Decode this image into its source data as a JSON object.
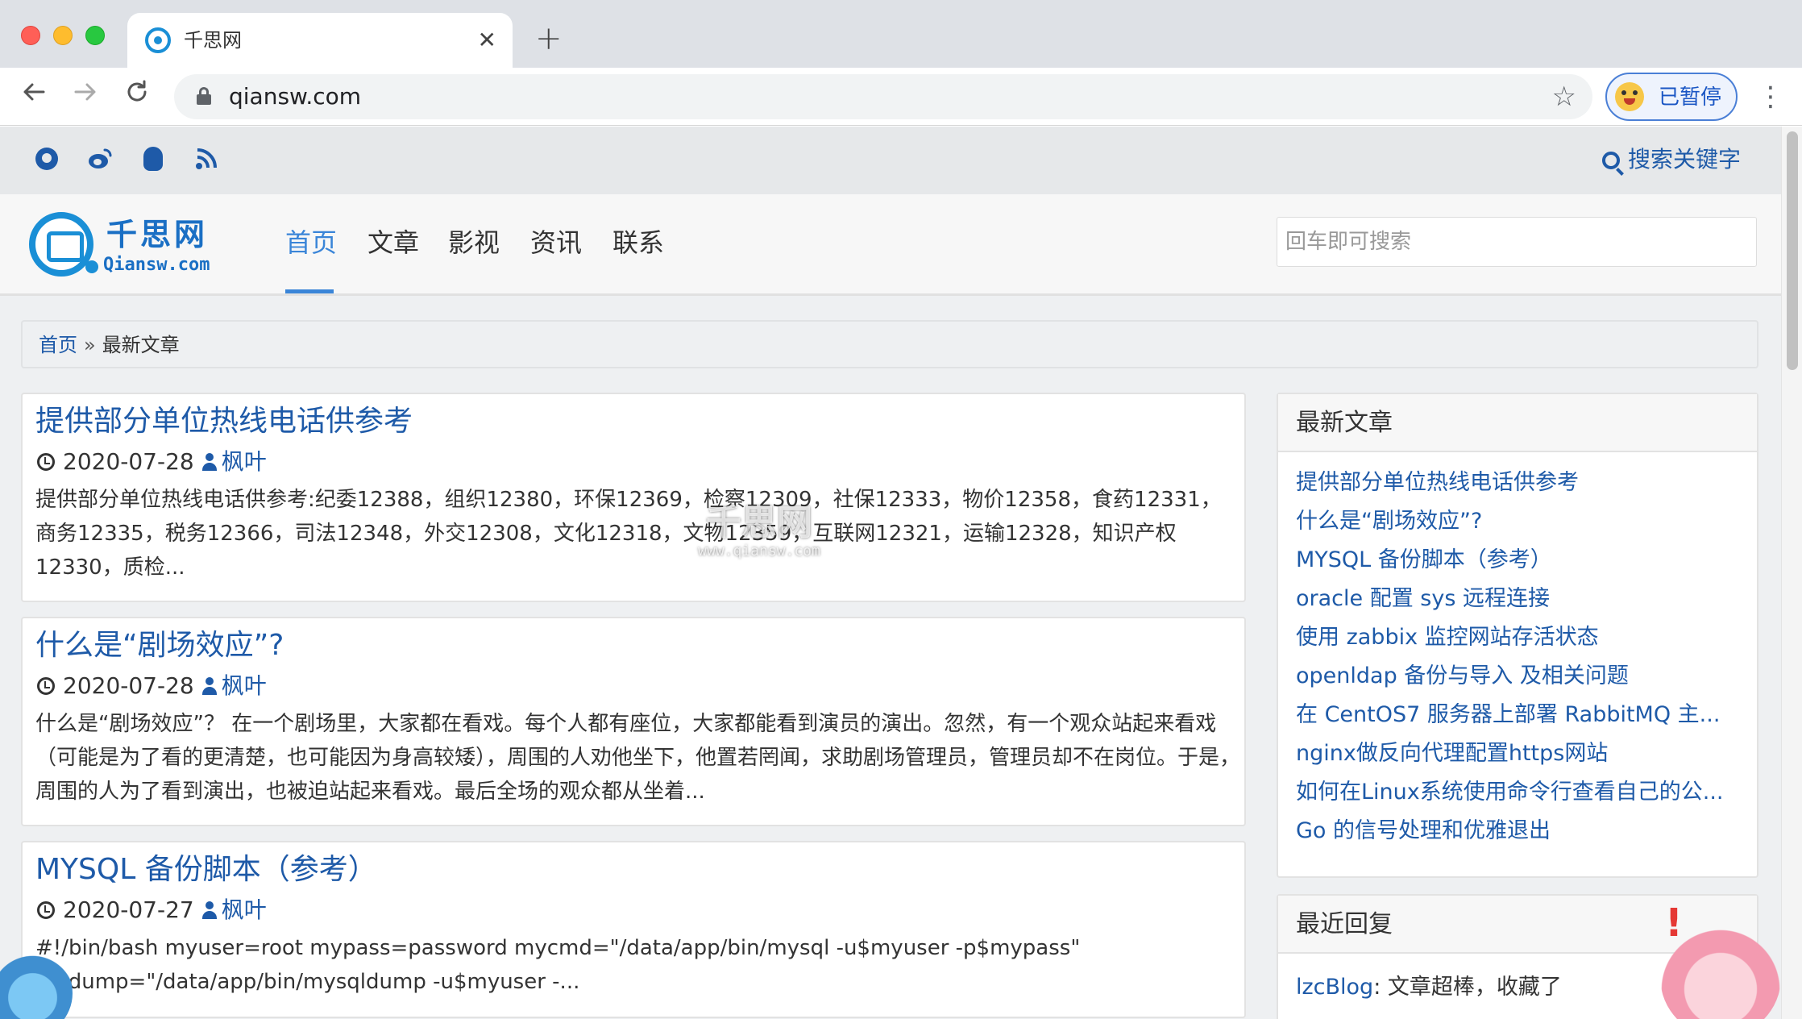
{
  "browser": {
    "tab_title": "千思网",
    "tab_close": "✕",
    "new_tab": "+",
    "url": "qiansw.com",
    "profile_label": "已暂停",
    "icons": {
      "back": "arrow-left-icon",
      "forward": "arrow-right-icon",
      "reload": "reload-icon",
      "lock": "lock-icon",
      "star": "star-icon",
      "menu": "kebab-menu-icon"
    }
  },
  "site": {
    "topbar": {
      "social_icons": [
        "github-icon",
        "weibo-icon",
        "qq-icon",
        "rss-icon"
      ],
      "search_label": "搜索关键字"
    },
    "logo": {
      "cn": "千思网",
      "en": "Qiansw.com"
    },
    "nav": [
      {
        "label": "首页",
        "active": true
      },
      {
        "label": "文章",
        "active": false
      },
      {
        "label": "影视",
        "active": false
      },
      {
        "label": "资讯",
        "active": false
      },
      {
        "label": "联系",
        "active": false
      }
    ],
    "search_placeholder": "回车即可搜索",
    "breadcrumb": {
      "home": "首页",
      "separator": "»",
      "current": "最新文章"
    },
    "posts": [
      {
        "title": "提供部分单位热线电话供参考",
        "date": "2020-07-28",
        "author": "枫叶",
        "excerpt": "提供部分单位热线电话供参考:纪委12388，组织12380，环保12369，检察12309，社保12333，物价12358，食药12331，商务12335，税务12366，司法12348，外交12308，文化12318，文物12359，互联网12321，运输12328，知识产权12330，质检..."
      },
      {
        "title": "什么是“剧场效应”?",
        "date": "2020-07-28",
        "author": "枫叶",
        "excerpt": "什么是“剧场效应”？ 在一个剧场里，大家都在看戏。每个人都有座位，大家都能看到演员的演出。忽然，有一个观众站起来看戏（可能是为了看的更清楚，也可能因为身高较矮），周围的人劝他坐下，他置若罔闻，求助剧场管理员，管理员却不在岗位。于是，周围的人为了看到演出，也被迫站起来看戏。最后全场的观众都从坐着..."
      },
      {
        "title": "MYSQL 备份脚本（参考）",
        "date": "2020-07-27",
        "author": "枫叶",
        "excerpt": "#!/bin/bash myuser=root mypass=password mycmd=\"/data/app/bin/mysql -u$myuser -p$mypass\" mydump=\"/data/app/bin/mysqldump -u$myuser -..."
      }
    ],
    "sidebar": {
      "latest_title": "最新文章",
      "latest_items": [
        "提供部分单位热线电话供参考",
        "什么是“剧场效应”?",
        "MYSQL 备份脚本（参考）",
        "oracle 配置 sys 远程连接",
        "使用 zabbix 监控网站存活状态",
        "openldap 备份与导入 及相关问题",
        "在 CentOS7 服务器上部署 RabbitMQ 主...",
        "nginx做反向代理配置https网站",
        "如何在Linux系统使用命令行查看自己的公...",
        "Go 的信号处理和优雅退出"
      ],
      "replies_title": "最近回复",
      "replies": [
        {
          "user": "lzcBlog",
          "text": ": 文章超棒，收藏了"
        }
      ]
    },
    "watermark": {
      "cn": "千思网",
      "en": "www.qiansw.com"
    }
  },
  "colors": {
    "link": "#1e5aa8",
    "nav_active": "#3a85d8",
    "logo": "#1a8fd6"
  }
}
